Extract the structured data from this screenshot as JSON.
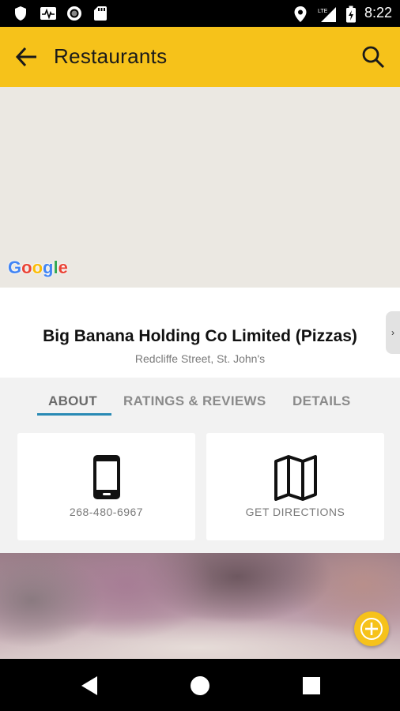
{
  "status_bar": {
    "time": "8:22",
    "left_icons": [
      "shield-icon",
      "activity-icon",
      "record-icon",
      "sd-card-icon"
    ],
    "right_icons": [
      "location-icon",
      "lte-signal-icon",
      "battery-charging-icon"
    ],
    "network_label": "LTE"
  },
  "app_bar": {
    "title": "Restaurants",
    "background": "#f6c21a"
  },
  "map": {
    "attribution_letters": [
      "G",
      "o",
      "o",
      "g",
      "l",
      "e"
    ]
  },
  "place": {
    "name": "Big Banana Holding Co Limited (Pizzas)",
    "address": "Redcliffe Street, St. John's"
  },
  "tabs": [
    {
      "label": "ABOUT",
      "active": true
    },
    {
      "label": "RATINGS & REVIEWS",
      "active": false
    },
    {
      "label": "DETAILS",
      "active": false
    }
  ],
  "actions": {
    "phone_label": "268-480-6967",
    "directions_label": "GET DIRECTIONS"
  },
  "colors": {
    "accent": "#f6c21a",
    "tab_indicator": "#2a8ab5"
  }
}
